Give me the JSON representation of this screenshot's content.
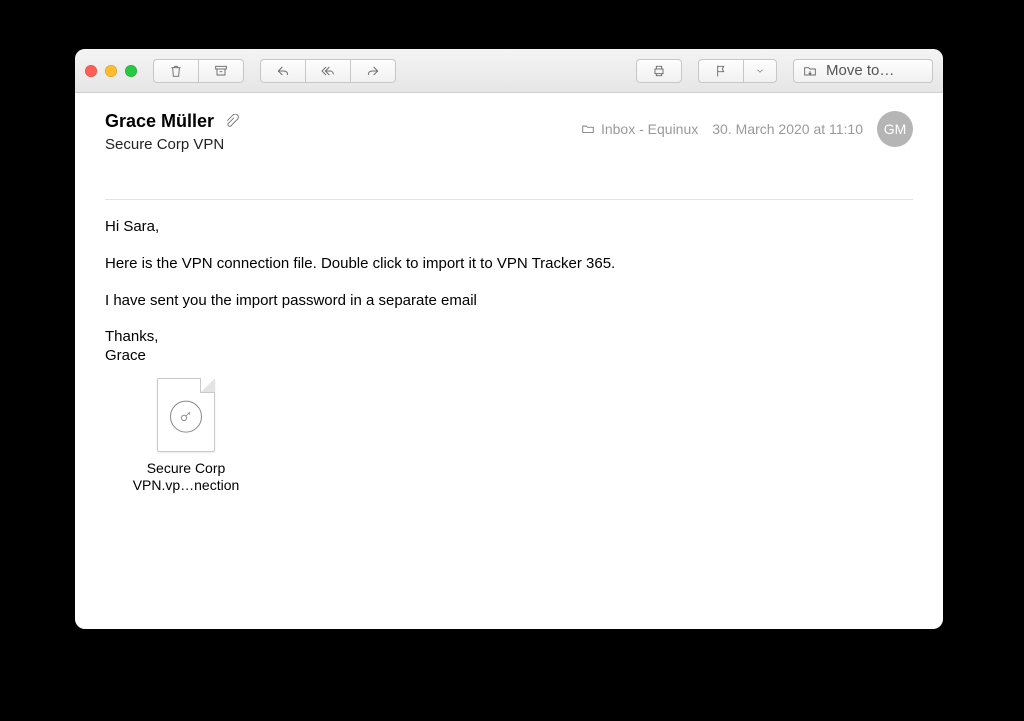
{
  "colors": {
    "traffic_close": "#ff5f57",
    "traffic_min": "#febc2e",
    "traffic_max": "#28c840",
    "flag": "#ec3b2f"
  },
  "toolbar": {
    "move_to_label": "Move to…"
  },
  "message": {
    "from_name": "Grace Müller",
    "subject": "Secure Corp VPN",
    "folder_label": "Inbox - Equinux",
    "date": "30. March 2020 at 11:10",
    "avatar_initials": "GM",
    "body": {
      "greeting": "Hi Sara,",
      "line1": "Here is the VPN connection file. Double click to import it to VPN Tracker 365.",
      "line2": "I have sent you the import password in a separate email",
      "sig_thanks": "Thanks,",
      "sig_name": "Grace"
    },
    "attachment": {
      "display_name_line1": "Secure Corp",
      "display_name_line2": "VPN.vp…nection"
    }
  }
}
